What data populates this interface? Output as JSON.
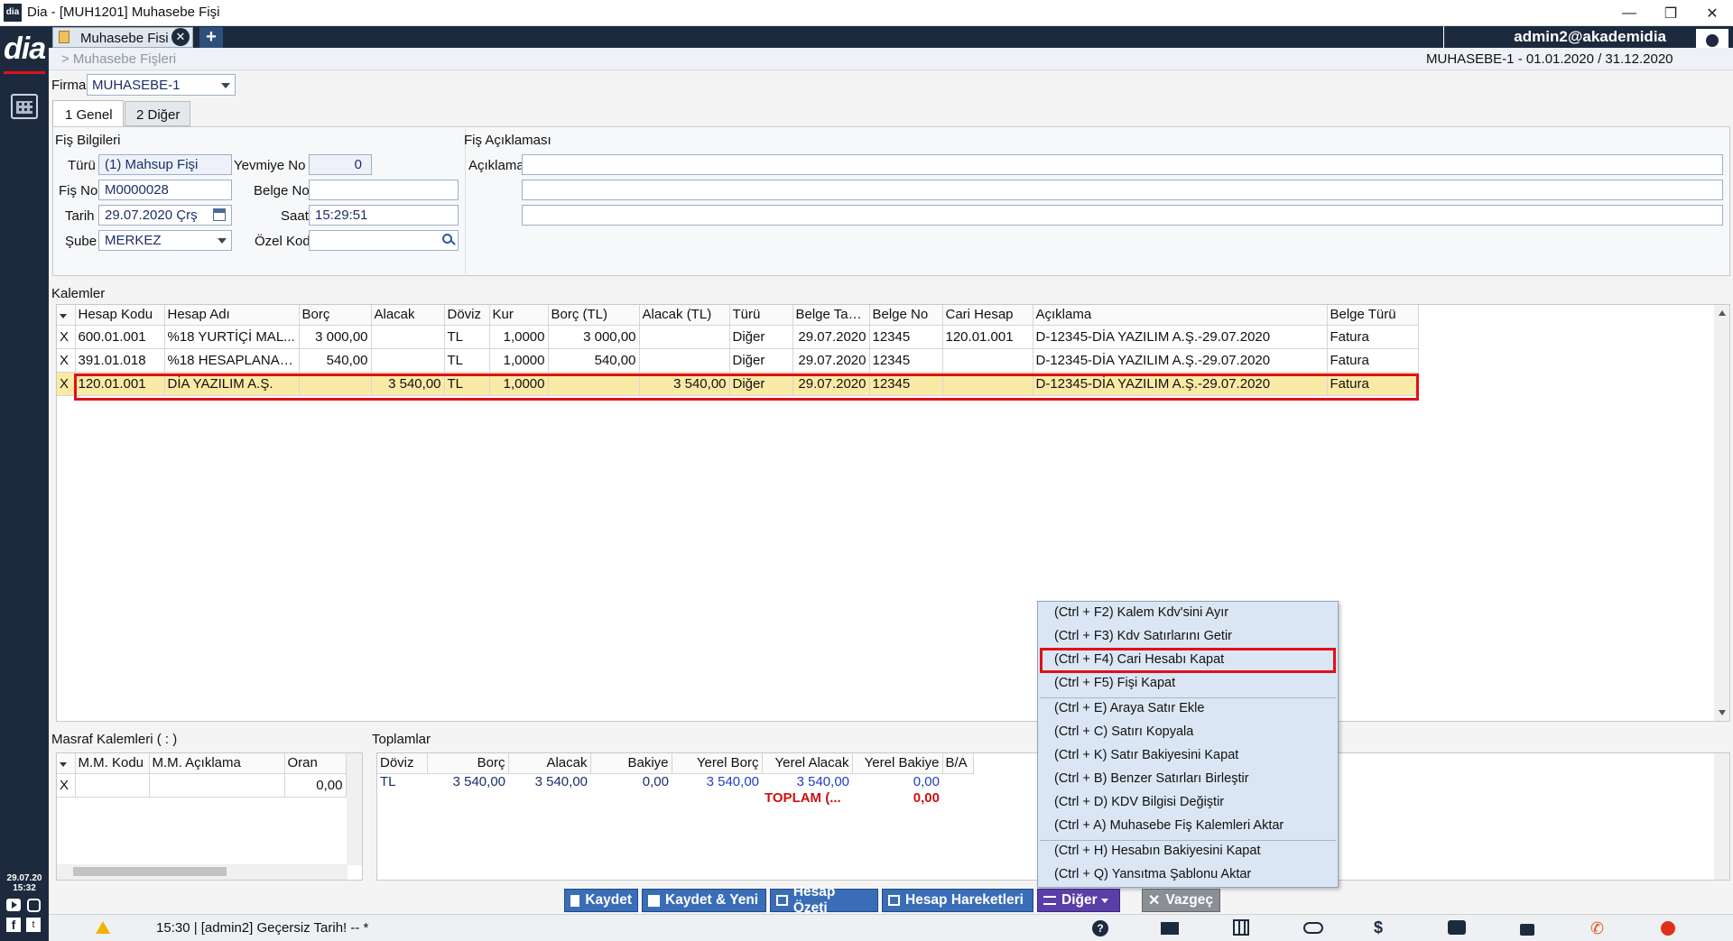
{
  "window": {
    "title": "Dia - [MUH1201] Muhasebe Fişi",
    "minimize": "—",
    "maximize": "❐",
    "close": "✕"
  },
  "tab": {
    "label": "Muhasebe Fisi",
    "close": "✕",
    "add": "+"
  },
  "user": {
    "name": "admin2@akademidia"
  },
  "breadcrumb": "> Muhasebe Fişleri",
  "period": "MUHASEBE-1 -  01.01.2020 / 31.12.2020",
  "firma": {
    "label": "Firma",
    "value": "MUHASEBE-1"
  },
  "subtabs": [
    {
      "label": "1 Genel"
    },
    {
      "label": "2 Diğer"
    }
  ],
  "fis_bilgileri": {
    "section": "Fiş Bilgileri",
    "turu_label": "Türü",
    "turu": "(1) Mahsup Fişi",
    "yevmiye_label": "Yevmiye No",
    "yevmiye": "0",
    "fisno_label": "Fiş No",
    "fisno": "M0000028",
    "belgeno_label": "Belge No",
    "belgeno": "",
    "tarih_label": "Tarih",
    "tarih": "29.07.2020 Çrş",
    "saat_label": "Saat",
    "saat": "15:29:51",
    "sube_label": "Şube",
    "sube": "MERKEZ",
    "ozelkod_label": "Özel Kod",
    "ozelkod": ""
  },
  "fis_aciklamasi": {
    "section": "Fiş Açıklaması",
    "aciklama_label": "Açıklama",
    "lines": [
      "",
      "",
      ""
    ]
  },
  "kalemler": {
    "section": "Kalemler",
    "columns": [
      "",
      "Hesap Kodu",
      "Hesap Adı",
      "Borç",
      "Alacak",
      "Döviz",
      "Kur",
      "Borç (TL)",
      "Alacak (TL)",
      "Türü",
      "Belge Tarihi",
      "Belge No",
      "Cari Hesap",
      "Açıklama",
      "Belge Türü"
    ],
    "rows": [
      [
        "X",
        "600.01.001",
        "%18 YURTİÇİ MAL...",
        "3 000,00",
        "",
        "TL",
        "1,0000",
        "3 000,00",
        "",
        "Diğer",
        "29.07.2020",
        "12345",
        "120.01.001",
        "D-12345-DİA YAZILIM A.Ş.-29.07.2020",
        "Fatura"
      ],
      [
        "X",
        "391.01.018",
        "%18 HESAPLANAN ...",
        "540,00",
        "",
        "TL",
        "1,0000",
        "540,00",
        "",
        "Diğer",
        "29.07.2020",
        "12345",
        "",
        "D-12345-DİA YAZILIM A.Ş.-29.07.2020",
        "Fatura"
      ],
      [
        "X",
        "120.01.001",
        "DİA YAZILIM A.Ş.",
        "",
        "3 540,00",
        "TL",
        "1,0000",
        "",
        "3 540,00",
        "Diğer",
        "29.07.2020",
        "12345",
        "",
        "D-12345-DİA YAZILIM A.Ş.-29.07.2020",
        "Fatura"
      ]
    ]
  },
  "masraf": {
    "section": "Masraf Kalemleri ( : )",
    "columns": [
      "",
      "M.M. Kodu",
      "M.M. Açıklama",
      "Oran"
    ],
    "row": [
      "X",
      "",
      "",
      "0,00"
    ]
  },
  "toplamlar": {
    "section": "Toplamlar",
    "columns": [
      "Döviz",
      "Borç",
      "Alacak",
      "Bakiye",
      "Yerel Borç",
      "Yerel Alacak",
      "Yerel Bakiye",
      "B/A"
    ],
    "row": [
      "TL",
      "3 540,00",
      "3 540,00",
      "0,00",
      "3 540,00",
      "3 540,00",
      "0,00",
      ""
    ],
    "total_label": "TOPLAM (...",
    "total_value": "0,00"
  },
  "context_menu": {
    "items": [
      "(Ctrl + F2) Kalem Kdv'sini Ayır",
      "(Ctrl + F3) Kdv Satırlarını Getir",
      "(Ctrl + F4) Cari Hesabı Kapat",
      "(Ctrl + F5) Fişi Kapat",
      "(Ctrl + E) Araya Satır Ekle",
      "(Ctrl + C) Satırı Kopyala",
      "(Ctrl + K) Satır Bakiyesini Kapat",
      "(Ctrl + B) Benzer Satırları Birleştir",
      "(Ctrl + D) KDV Bilgisi Değiştir",
      "(Ctrl + A) Muhasebe Fiş Kalemleri Aktar",
      "(Ctrl + H) Hesabın Bakiyesini Kapat",
      "(Ctrl + Q) Yansıtma Şablonu Aktar"
    ]
  },
  "buttons": {
    "kaydet": "Kaydet",
    "kaydet_yeni": "Kaydet & Yeni",
    "hesap_ozeti": "Hesap Özeti",
    "hesap_hareketleri": "Hesap Hareketleri",
    "diger": "Diğer",
    "vazgec": "Vazgeç"
  },
  "status": {
    "message": "15:30 | [admin2] Geçersiz Tarih! -- *",
    "date": "29.07.20",
    "time": "15:32"
  },
  "logo": "dia",
  "colors": {
    "dark": "#1d2a3e",
    "accent": "#3a6db7",
    "highlight": "#e0101a",
    "selected_row": "#fbeaa6",
    "menu_bg": "#dbe6f4"
  }
}
